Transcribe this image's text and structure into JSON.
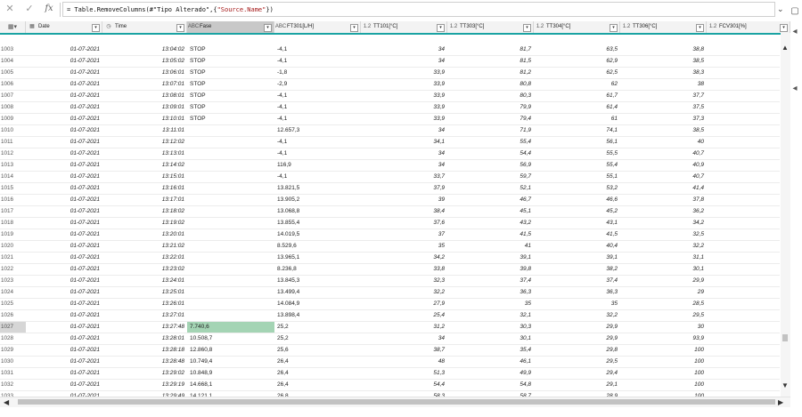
{
  "formula_bar": {
    "cancel_icon": "close-icon",
    "commit_icon": "check-icon",
    "fx_label": "fx",
    "formula_prefix": "= Table.RemoveColumns(#\"Tipo Alterado\",{",
    "formula_string": "\"Source.Name\"",
    "formula_suffix": "})"
  },
  "columns": [
    {
      "key": "date",
      "type_icon": "▦",
      "label": "Date"
    },
    {
      "key": "time",
      "type_icon": "◷",
      "label": "Time"
    },
    {
      "key": "fase",
      "type_icon": "ABC",
      "label": "Fase",
      "selected": true
    },
    {
      "key": "ft301",
      "type_icon": "ABC",
      "label": "FT301[L/H]"
    },
    {
      "key": "tt101",
      "type_icon": "1.2",
      "label": "TT101[°C]"
    },
    {
      "key": "tt303",
      "type_icon": "1.2",
      "label": "TT303[°C]"
    },
    {
      "key": "tt304",
      "type_icon": "1.2",
      "label": "TT304[°C]"
    },
    {
      "key": "tt306",
      "type_icon": "1.2",
      "label": "TT306[°C]"
    },
    {
      "key": "fcv301",
      "type_icon": "1.2",
      "label": "FCV301[%]"
    }
  ],
  "rows": [
    {
      "idx": "1003",
      "date": "01-07-2021",
      "time": "13:04:02",
      "fase": "STOP",
      "ft": "-4,1",
      "t1": "34",
      "t3": "81,7",
      "t4": "63,5",
      "t6": "38,8",
      "fcv": ""
    },
    {
      "idx": "1004",
      "date": "01-07-2021",
      "time": "13:05:02",
      "fase": "STOP",
      "ft": "-4,1",
      "t1": "34",
      "t3": "81,5",
      "t4": "62,9",
      "t6": "38,5",
      "fcv": ""
    },
    {
      "idx": "1005",
      "date": "01-07-2021",
      "time": "13:06:01",
      "fase": "STOP",
      "ft": "-1,8",
      "t1": "33,9",
      "t3": "81,2",
      "t4": "62,5",
      "t6": "38,3",
      "fcv": ""
    },
    {
      "idx": "1006",
      "date": "01-07-2021",
      "time": "13:07:01",
      "fase": "STOP",
      "ft": "-2,9",
      "t1": "33,9",
      "t3": "80,8",
      "t4": "62",
      "t6": "38",
      "fcv": ""
    },
    {
      "idx": "1007",
      "date": "01-07-2021",
      "time": "13:08:01",
      "fase": "STOP",
      "ft": "-4,1",
      "t1": "33,9",
      "t3": "80,3",
      "t4": "61,7",
      "t6": "37,7",
      "fcv": ""
    },
    {
      "idx": "1008",
      "date": "01-07-2021",
      "time": "13:09:01",
      "fase": "STOP",
      "ft": "-4,1",
      "t1": "33,9",
      "t3": "79,9",
      "t4": "61,4",
      "t6": "37,5",
      "fcv": ""
    },
    {
      "idx": "1009",
      "date": "01-07-2021",
      "time": "13:10:01",
      "fase": "STOP",
      "ft": "-4,1",
      "t1": "33,9",
      "t3": "79,4",
      "t4": "61",
      "t6": "37,3",
      "fcv": ""
    },
    {
      "idx": "1010",
      "date": "01-07-2021",
      "time": "13:11:01",
      "fase": "",
      "ft": "12.657,3",
      "t1": "34",
      "t3": "71,9",
      "t4": "74,1",
      "t6": "38,5",
      "fcv": ""
    },
    {
      "idx": "1011",
      "date": "01-07-2021",
      "time": "13:12:02",
      "fase": "",
      "ft": "-4,1",
      "t1": "34,1",
      "t3": "55,4",
      "t4": "56,1",
      "t6": "40",
      "fcv": ""
    },
    {
      "idx": "1012",
      "date": "01-07-2021",
      "time": "13:13:01",
      "fase": "",
      "ft": "-4,1",
      "t1": "34",
      "t3": "54,4",
      "t4": "55,5",
      "t6": "40,7",
      "fcv": ""
    },
    {
      "idx": "1013",
      "date": "01-07-2021",
      "time": "13:14:02",
      "fase": "",
      "ft": "116,9",
      "t1": "34",
      "t3": "56,9",
      "t4": "55,4",
      "t6": "40,9",
      "fcv": ""
    },
    {
      "idx": "1014",
      "date": "01-07-2021",
      "time": "13:15:01",
      "fase": "",
      "ft": "-4,1",
      "t1": "33,7",
      "t3": "59,7",
      "t4": "55,1",
      "t6": "40,7",
      "fcv": ""
    },
    {
      "idx": "1015",
      "date": "01-07-2021",
      "time": "13:16:01",
      "fase": "",
      "ft": "13.821,5",
      "t1": "37,9",
      "t3": "52,1",
      "t4": "53,2",
      "t6": "41,4",
      "fcv": ""
    },
    {
      "idx": "1016",
      "date": "01-07-2021",
      "time": "13:17:01",
      "fase": "",
      "ft": "13.905,2",
      "t1": "39",
      "t3": "46,7",
      "t4": "46,6",
      "t6": "37,8",
      "fcv": ""
    },
    {
      "idx": "1017",
      "date": "01-07-2021",
      "time": "13:18:02",
      "fase": "",
      "ft": "13.068,8",
      "t1": "38,4",
      "t3": "45,1",
      "t4": "45,2",
      "t6": "36,2",
      "fcv": ""
    },
    {
      "idx": "1018",
      "date": "01-07-2021",
      "time": "13:19:02",
      "fase": "",
      "ft": "13.855,4",
      "t1": "37,6",
      "t3": "43,2",
      "t4": "43,1",
      "t6": "34,2",
      "fcv": ""
    },
    {
      "idx": "1019",
      "date": "01-07-2021",
      "time": "13:20:01",
      "fase": "",
      "ft": "14.019,5",
      "t1": "37",
      "t3": "41,5",
      "t4": "41,5",
      "t6": "32,5",
      "fcv": ""
    },
    {
      "idx": "1020",
      "date": "01-07-2021",
      "time": "13:21:02",
      "fase": "",
      "ft": "8.529,6",
      "t1": "35",
      "t3": "41",
      "t4": "40,4",
      "t6": "32,2",
      "fcv": ""
    },
    {
      "idx": "1021",
      "date": "01-07-2021",
      "time": "13:22:01",
      "fase": "",
      "ft": "13.965,1",
      "t1": "34,2",
      "t3": "39,1",
      "t4": "39,1",
      "t6": "31,1",
      "fcv": ""
    },
    {
      "idx": "1022",
      "date": "01-07-2021",
      "time": "13:23:02",
      "fase": "",
      "ft": "8.236,8",
      "t1": "33,8",
      "t3": "39,8",
      "t4": "38,2",
      "t6": "30,1",
      "fcv": ""
    },
    {
      "idx": "1023",
      "date": "01-07-2021",
      "time": "13:24:01",
      "fase": "",
      "ft": "13.845,3",
      "t1": "32,3",
      "t3": "37,4",
      "t4": "37,4",
      "t6": "29,9",
      "fcv": ""
    },
    {
      "idx": "1024",
      "date": "01-07-2021",
      "time": "13:25:01",
      "fase": "",
      "ft": "13.499,4",
      "t1": "32,2",
      "t3": "36,3",
      "t4": "36,3",
      "t6": "29",
      "fcv": ""
    },
    {
      "idx": "1025",
      "date": "01-07-2021",
      "time": "13:26:01",
      "fase": "",
      "ft": "14.084,9",
      "t1": "27,9",
      "t3": "35",
      "t4": "35",
      "t6": "28,5",
      "fcv": ""
    },
    {
      "idx": "1026",
      "date": "01-07-2021",
      "time": "13:27:01",
      "fase": "",
      "ft": "13.898,4",
      "t1": "25,4",
      "t3": "32,1",
      "t4": "32,2",
      "t6": "29,5",
      "fcv": ""
    },
    {
      "idx": "1027",
      "date": "01-07-2021",
      "time": "13:27:48",
      "fase": "7.740,6",
      "ft": "25,2",
      "t1": "31,2",
      "t3": "30,3",
      "t4": "29,9",
      "t6": "30",
      "fcv": "",
      "current": true
    },
    {
      "idx": "1028",
      "date": "01-07-2021",
      "time": "13:28:01",
      "fase": "10.508,7",
      "ft": "25,2",
      "t1": "34",
      "t3": "30,1",
      "t4": "29,9",
      "t6": "93,9",
      "fcv": ""
    },
    {
      "idx": "1029",
      "date": "01-07-2021",
      "time": "13:28:18",
      "fase": "12.860,8",
      "ft": "25,6",
      "t1": "38,7",
      "t3": "35,4",
      "t4": "29,8",
      "t6": "100",
      "fcv": ""
    },
    {
      "idx": "1030",
      "date": "01-07-2021",
      "time": "13:28:48",
      "fase": "10.749,4",
      "ft": "26,4",
      "t1": "48",
      "t3": "46,1",
      "t4": "29,5",
      "t6": "100",
      "fcv": ""
    },
    {
      "idx": "1031",
      "date": "01-07-2021",
      "time": "13:29:02",
      "fase": "10.848,9",
      "ft": "26,4",
      "t1": "51,3",
      "t3": "49,9",
      "t4": "29,4",
      "t6": "100",
      "fcv": ""
    },
    {
      "idx": "1032",
      "date": "01-07-2021",
      "time": "13:29:19",
      "fase": "14.668,1",
      "ft": "26,4",
      "t1": "54,4",
      "t3": "54,8",
      "t4": "29,1",
      "t6": "100",
      "fcv": ""
    },
    {
      "idx": "1033",
      "date": "01-07-2021",
      "time": "13:29:49",
      "fase": "14.121,1",
      "ft": "26,8",
      "t1": "58,3",
      "t3": "58,7",
      "t4": "28,9",
      "t6": "100",
      "fcv": ""
    }
  ]
}
